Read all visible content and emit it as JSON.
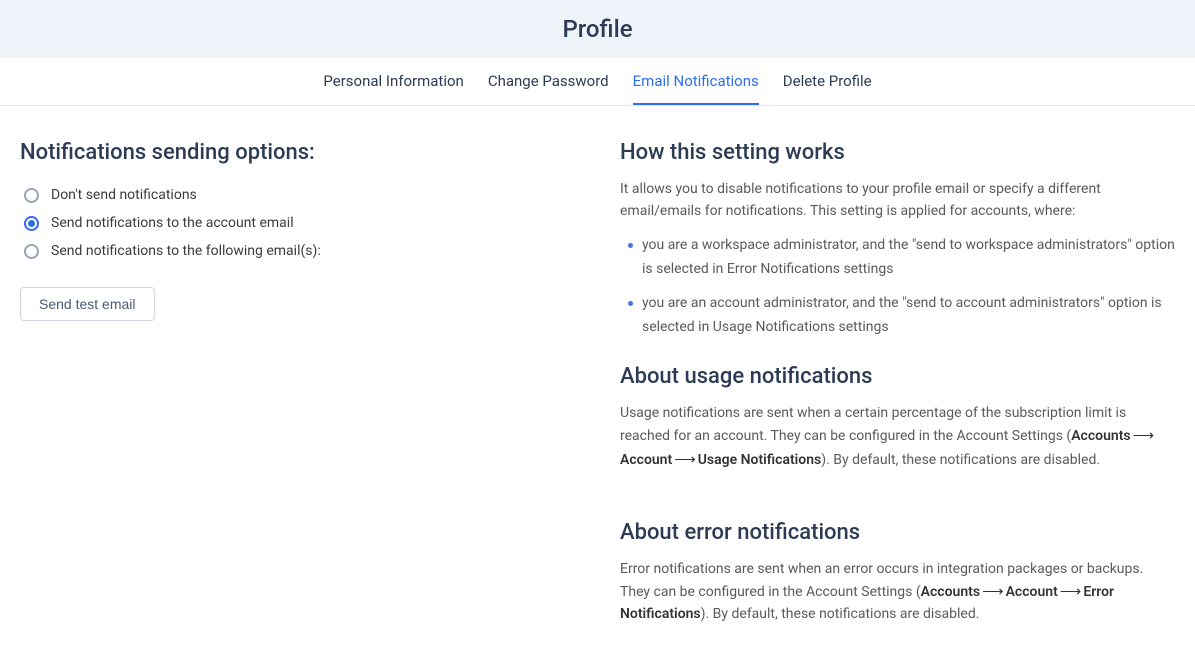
{
  "header": {
    "title": "Profile"
  },
  "tabs": [
    {
      "label": "Personal Information",
      "active": false
    },
    {
      "label": "Change Password",
      "active": false
    },
    {
      "label": "Email Notifications",
      "active": true
    },
    {
      "label": "Delete Profile",
      "active": false
    }
  ],
  "left": {
    "section_title": "Notifications sending options:",
    "radios": [
      {
        "label": "Don't send notifications",
        "selected": false
      },
      {
        "label": "Send notifications to the account email",
        "selected": true
      },
      {
        "label": "Send notifications to the following email(s):",
        "selected": false
      }
    ],
    "send_test_label": "Send test email"
  },
  "right": {
    "how_title": "How this setting works",
    "how_desc": "It allows you to disable notifications to your profile email or specify a different email/emails for notifications. This setting is applied for accounts, where:",
    "how_bullets": [
      "you are a workspace administrator, and the \"send to workspace administrators\" option is selected in Error Notifications settings",
      "you are an account administrator, and the \"send to account administrators\" option is selected in Usage Notifications settings"
    ],
    "usage_title": "About usage notifications",
    "usage_pre": "Usage notifications are sent when a certain percentage of the subscription limit is reached for an account. They can be configured in the Account Settings (",
    "usage_path": [
      "Accounts",
      "Account",
      "Usage Notifications"
    ],
    "usage_post": "). By default, these notifications are disabled.",
    "error_title": "About error notifications",
    "error_pre": "Error notifications are sent when an error occurs in integration packages or backups. They can be configured in the Account Settings (",
    "error_path": [
      "Accounts",
      "Account",
      "Error Notifications"
    ],
    "error_post": "). By default, these notifications are disabled."
  }
}
